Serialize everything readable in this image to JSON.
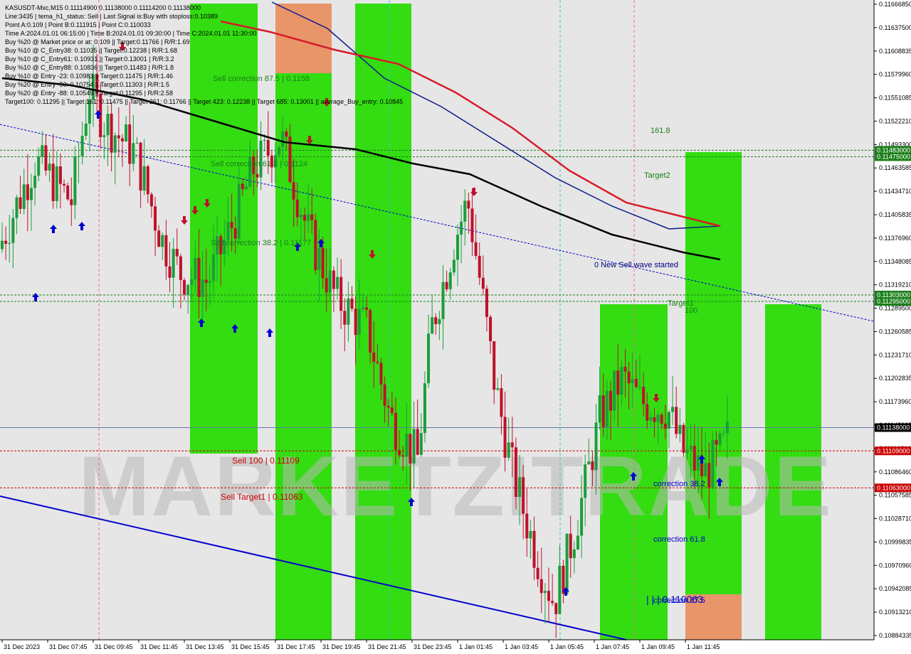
{
  "header": {
    "lines": [
      "KASUSDT-Mxc,M15  0.11114900 0.11138000 0.11114200 0.11138000",
      "Line:3435  |  tema_h1_status: Sell  |  Last Signal is:Buy with stoploss:0.10389",
      "Point A:0.109  |  Point B:0.111915  |  Point C:0.110033",
      "Time A:2024.01.01 06:15:00  |  Time B:2024.01.01 09:30:00  |  Time C:2024.01.01 11:30:00",
      "Buy %20 @ Market price or at: 0.109  ||  Target:0.11766  |  R/R:1.69",
      "Buy %10 @ C_Entry38: 0.11035  ||  Target:0.12238  |  R/R:1.68",
      "Buy %10 @ C_Entry61: 0.10931  ||  Target:0.13001  |  R/R:3.2",
      "Buy %10 @ C_Entry88: 0.10836  ||  Target:0.11483  |  R/R:1.8",
      "Buy %10 @ Entry -23: 0.10983  ||  Target:0.11475  |  R/R:1.46",
      "Buy %20 @ Entry -50: 0.10754  ||  Target:0.11303  |  R/R:1.5",
      "Buy %20 @ Entry -88: 0.10549  ||  Target:0.11295  |  R/R:2.58",
      "Target100: 0.11295  ||  Target 161: 0.11475  ||  Target 261: 0.11766  ||  Target 423: 0.12238  ||  Target 685: 0.13001  ||  average_Buy_entry: 0.10845"
    ]
  },
  "chart_data": {
    "type": "candlestick",
    "symbol": "KASUSDT-Mxc",
    "timeframe": "M15",
    "ylim": [
      0.10874,
      0.1167
    ],
    "y_ticks": [
      "0.11666850",
      "0.11637500",
      "0.11608835",
      "0.11579960",
      "0.11551085",
      "0.11522210",
      "0.11493300",
      "0.11463585",
      "0.11434710",
      "0.11405835",
      "0.11376960",
      "0.11348085",
      "0.11319210",
      "0.11289500",
      "0.11260585",
      "0.11231710",
      "0.11202835",
      "0.11173960",
      "0.11145085",
      "0.11116210",
      "0.11086460",
      "0.11057585",
      "0.11028710",
      "0.10999835",
      "0.10970960",
      "0.10942085",
      "0.10913210",
      "0.10884335"
    ],
    "x_ticks": [
      "31 Dec 2023",
      "31 Dec 07:45",
      "31 Dec 09:45",
      "31 Dec 11:45",
      "31 Dec 13:45",
      "31 Dec 15:45",
      "31 Dec 17:45",
      "31 Dec 19:45",
      "31 Dec 21:45",
      "31 Dec 23:45",
      "1 Jan 01:45",
      "1 Jan 03:45",
      "1 Jan 05:45",
      "1 Jan 07:45",
      "1 Jan 09:45",
      "1 Jan 11:45"
    ],
    "price_tags": [
      {
        "value": 0.11483,
        "label": "0.11483000",
        "color": "#1a7f1a"
      },
      {
        "value": 0.11475,
        "label": "0.11475000",
        "color": "#1a7f1a"
      },
      {
        "value": 0.11303,
        "label": "0.11303000",
        "color": "#1a7f1a"
      },
      {
        "value": 0.11295,
        "label": "0.11295000",
        "color": "#1a7f1a"
      },
      {
        "value": 0.11138,
        "label": "0.11138000",
        "color": "#000000"
      },
      {
        "value": 0.11109,
        "label": "0.11109000",
        "color": "#cc0000"
      },
      {
        "value": 0.11063,
        "label": "0.11063000",
        "color": "#cc0000"
      }
    ],
    "zones": [
      {
        "from": 0.5,
        "to": 1.0,
        "color": "#33dd11"
      },
      {
        "from": 1.13,
        "to": 1.47,
        "color": "#33dd11"
      },
      {
        "from": 1.63,
        "to": 1.88,
        "color": "#33dd11"
      },
      {
        "from": 2.7,
        "to": 2.95,
        "color": "#33dd11"
      },
      {
        "from": 3.25,
        "to": 3.45,
        "color": "#33dd11"
      },
      {
        "from": 3.6,
        "to": 3.8,
        "color": "#33dd11"
      }
    ],
    "annotations": [
      {
        "text": "Sell correction 87.5 | 0.1158",
        "color": "#1a7f1a"
      },
      {
        "text": "Sell correction 61.8 | 0.1124",
        "color": "#1a7f1a"
      },
      {
        "text": "Sell correction 38.2 | 0.11177",
        "color": "#1a7f1a"
      },
      {
        "text": "Sell 100 | 0.11109",
        "color": "#cc0000"
      },
      {
        "text": "Sell Target1 | 0.11063",
        "color": "#cc0000"
      },
      {
        "text": "161.8",
        "color": "#1a7f1a"
      },
      {
        "text": "Target2",
        "color": "#1a7f1a"
      },
      {
        "text": "Target1",
        "color": "#1a7f1a"
      },
      {
        "text": "100",
        "color": "#1a7f1a"
      },
      {
        "text": "0 New Sell wave started",
        "color": "#000080"
      },
      {
        "text": "correction 38.2",
        "color": "#0000cc"
      },
      {
        "text": "correction 61.8",
        "color": "#0000cc"
      },
      {
        "text": "correction 87.5",
        "color": "#0000cc"
      },
      {
        "text": "| | | 0.110063",
        "color": "#0000cc"
      }
    ]
  },
  "watermark": "MARKETZITRADE",
  "colors": {
    "bull": "#1a9e3a",
    "bear": "#c0102a",
    "zone_green": "#33dd11",
    "zone_orange": "#e8956a",
    "ma_red": "#d91a2a",
    "ma_black": "#000000",
    "ma_navy": "#0a1a8a",
    "trend_blue": "#0000cc"
  }
}
